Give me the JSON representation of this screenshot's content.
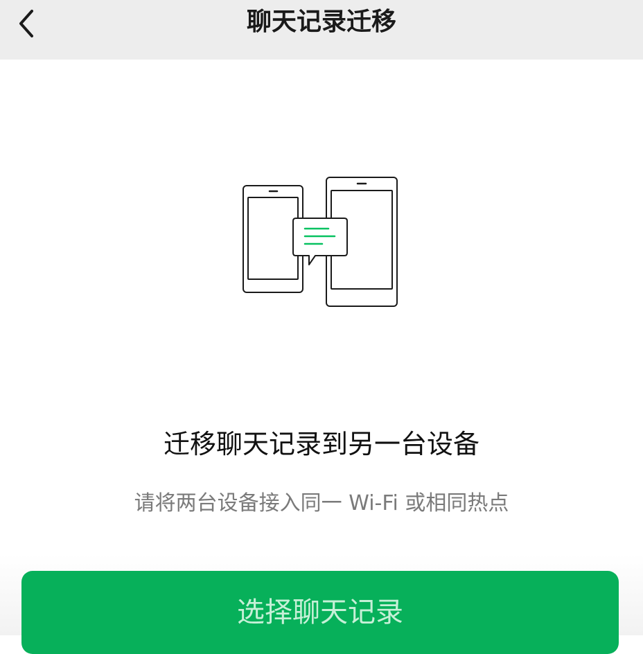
{
  "header": {
    "title": "聊天记录迁移",
    "back_icon": "chevron-left-icon"
  },
  "illustration": {
    "icon": "devices-transfer-icon",
    "line_color": "#1a1a1a",
    "accent_color": "#07c160"
  },
  "main": {
    "heading": "迁移聊天记录到另一台设备",
    "subtext": "请将两台设备接入同一 Wi-Fi 或相同热点"
  },
  "actions": {
    "select_label": "选择聊天记录",
    "button_color": "#07b05a"
  }
}
